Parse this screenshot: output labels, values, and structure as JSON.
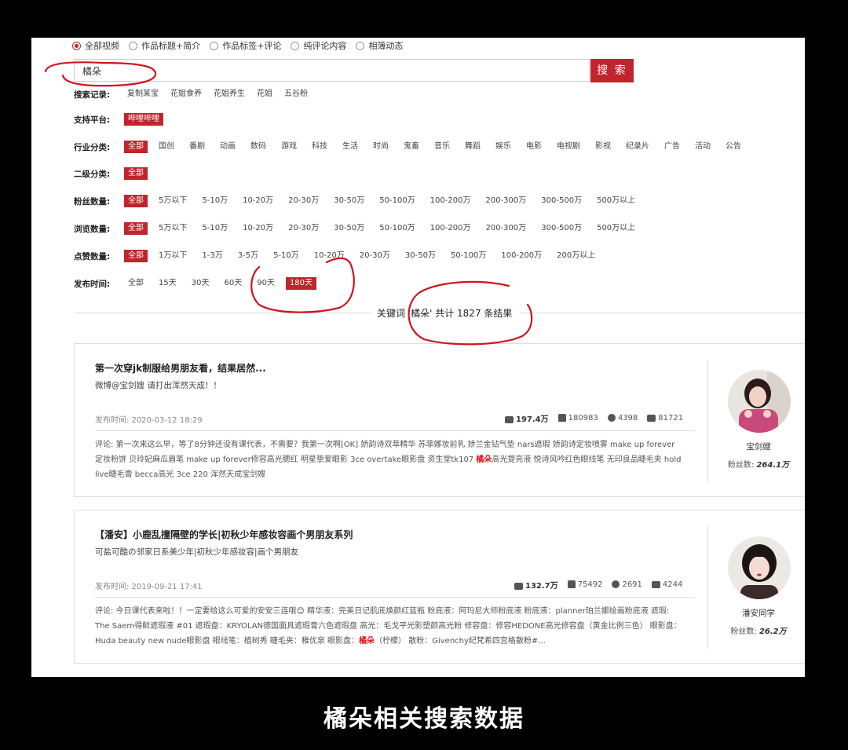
{
  "search_scope": {
    "options": [
      "全部视频",
      "作品标题+简介",
      "作品标签+评论",
      "纯评论内容",
      "相簿动态"
    ],
    "selected_index": 0
  },
  "search": {
    "value": "橘朵",
    "button_label": "搜 索"
  },
  "history": {
    "label": "搜索记录:",
    "items": [
      "复制某宝",
      "花姐食养",
      "花姐养生",
      "花姐",
      "五谷粉"
    ]
  },
  "filters": [
    {
      "label": "支持平台:",
      "options": [
        "哔哩哔哩"
      ],
      "selected_index": 0
    },
    {
      "label": "行业分类:",
      "options": [
        "全部",
        "国创",
        "番剧",
        "动画",
        "数码",
        "游戏",
        "科技",
        "生活",
        "时尚",
        "鬼畜",
        "音乐",
        "舞蹈",
        "娱乐",
        "电影",
        "电视剧",
        "影视",
        "纪录片",
        "广告",
        "活动",
        "公告"
      ],
      "selected_index": 0
    },
    {
      "label": "二级分类:",
      "options": [
        "全部"
      ],
      "selected_index": 0
    },
    {
      "label": "粉丝数量:",
      "options": [
        "全部",
        "5万以下",
        "5-10万",
        "10-20万",
        "20-30万",
        "30-50万",
        "50-100万",
        "100-200万",
        "200-300万",
        "300-500万",
        "500万以上"
      ],
      "selected_index": 0
    },
    {
      "label": "浏览数量:",
      "options": [
        "全部",
        "5万以下",
        "5-10万",
        "10-20万",
        "20-30万",
        "30-50万",
        "50-100万",
        "100-200万",
        "200-300万",
        "300-500万",
        "500万以上"
      ],
      "selected_index": 0
    },
    {
      "label": "点赞数量:",
      "options": [
        "全部",
        "1万以下",
        "1-3万",
        "3-5万",
        "5-10万",
        "10-20万",
        "20-30万",
        "30-50万",
        "50-100万",
        "100-200万",
        "200万以上"
      ],
      "selected_index": 0
    },
    {
      "label": "发布时间:",
      "options": [
        "全部",
        "15天",
        "30天",
        "60天",
        "90天",
        "180天"
      ],
      "selected_index": 5
    }
  ],
  "result_summary": "关键词 '橘朵' 共计 1827 条结果",
  "results": [
    {
      "title": "第一次穿jk制服给男朋友看，结果居然...",
      "desc": "微博@宝剑嫂 请打出浑然天成！！",
      "time": "发布时间: 2020-03-12 18:29",
      "views": "197.4万",
      "likes": "180983",
      "comments": "4398",
      "favorites": "81721",
      "comment_before": "评论: 第一次来这么早，等了8分钟还没有课代表，不需要？我第一次啊[OK] 娇韵诗双萃精华 苏菲娜妆前乳 娇兰金钻气垫 nars遮瑕 娇韵诗定妆喷雾 make up forever定妆粉饼 贝玲妃麻瓜眉笔 make up forever修容高光腮红 明星挚爱眼影 3ce overtake眼影盘 资生堂tk107 ",
      "comment_highlight": "橘朵",
      "comment_after": "高光提亮液 悦诗风吟红色眼线笔 无印良品睫毛夹 hold live睫毛膏 becca高光 3ce 220 浑然天成宝剑嫂",
      "author": "宝剑嫂",
      "fans_label": "粉丝数:",
      "fans": "264.1万",
      "avatar_color": "#c94a7a"
    },
    {
      "title": "【潘安】小鹿乱撞隔壁的学长|初秋少年感妆容画个男朋友系列",
      "desc": "可盐可酷の邻家日系美少年|初秋少年感妆容|画个男朋友",
      "time": "发布时间: 2019-09-21 17:41",
      "views": "132.7万",
      "likes": "75492",
      "comments": "2691",
      "favorites": "4244",
      "comment_before": "评论: 今日课代表来啦！！一定要给这么可爱的安安三连哦😊 精华液：完美日记肌底焕颜红蓝瓶 粉底液：阿玛尼大师粉底液 粉底液：planner珀兰娜绘画粉底液 遮瑕: The Saem得鲜遮瑕液  #01 遮瑕盘：KRYOLAN德国面具遮瑕膏六色遮瑕盘 高光：毛戈平光影塑颜高光粉 修容盘：修容HEDONE高光修容盘（黄金比例三色） 眼影盘：Huda beauty new nude眼影盘 眼线笔：植树秀 睫毛夹：稚优泉 眼影盘：",
      "comment_highlight": "橘朵",
      "comment_after": "（柠檬） 散粉：Givenchy纪梵希四宫格散粉#...",
      "author": "潘安同学",
      "fans_label": "粉丝数:",
      "fans": "26.2万",
      "avatar_color": "#3a2a2a"
    }
  ],
  "caption": "橘朵相关搜索数据",
  "colors": {
    "accent": "#c0242c",
    "highlight": "#e0141c",
    "annotation": "#d0141c"
  }
}
